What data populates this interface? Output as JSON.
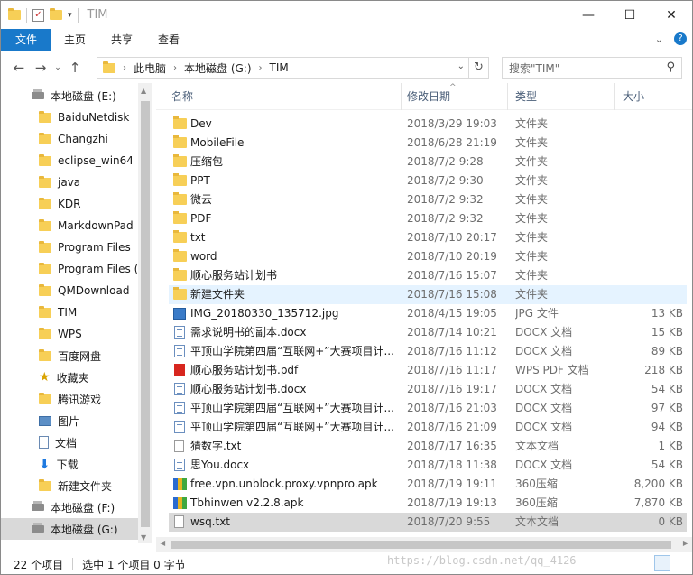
{
  "window": {
    "title": "TIM",
    "controls": [
      "minimize",
      "maximize",
      "close"
    ]
  },
  "ribbon": {
    "tabs": [
      "文件",
      "主页",
      "共享",
      "查看"
    ]
  },
  "nav": {
    "breadcrumb": [
      "此电脑",
      "本地磁盘 (G:)",
      "TIM"
    ],
    "search_placeholder": "搜索\"TIM\""
  },
  "sidebar": [
    {
      "label": "本地磁盘 (E:)",
      "icon": "drive-icon",
      "indent": 0
    },
    {
      "label": "BaiduNetdisk",
      "icon": "folder-icon",
      "indent": 1
    },
    {
      "label": "Changzhi",
      "icon": "folder-icon",
      "indent": 1
    },
    {
      "label": "eclipse_win64",
      "icon": "folder-icon",
      "indent": 1
    },
    {
      "label": "java",
      "icon": "folder-icon",
      "indent": 1
    },
    {
      "label": "KDR",
      "icon": "folder-icon",
      "indent": 1
    },
    {
      "label": "MarkdownPad",
      "icon": "folder-icon",
      "indent": 1
    },
    {
      "label": "Program Files",
      "icon": "folder-icon",
      "indent": 1
    },
    {
      "label": "Program Files (",
      "icon": "folder-icon",
      "indent": 1
    },
    {
      "label": "QMDownload",
      "icon": "folder-icon",
      "indent": 1
    },
    {
      "label": "TIM",
      "icon": "folder-icon",
      "indent": 1
    },
    {
      "label": "WPS",
      "icon": "folder-icon",
      "indent": 1
    },
    {
      "label": "百度网盘",
      "icon": "folder-icon",
      "indent": 1
    },
    {
      "label": "收藏夹",
      "icon": "star-icon",
      "indent": 1
    },
    {
      "label": "腾讯游戏",
      "icon": "folder-icon",
      "indent": 1
    },
    {
      "label": "图片",
      "icon": "picture-icon",
      "indent": 1
    },
    {
      "label": "文档",
      "icon": "document-icon",
      "indent": 1
    },
    {
      "label": "下载",
      "icon": "download-icon",
      "indent": 1
    },
    {
      "label": "新建文件夹",
      "icon": "folder-icon",
      "indent": 1
    },
    {
      "label": "本地磁盘 (F:)",
      "icon": "drive-icon",
      "indent": 0
    },
    {
      "label": "本地磁盘 (G:)",
      "icon": "drive-icon",
      "indent": 0,
      "selected": true
    }
  ],
  "columns": {
    "name": "名称",
    "date": "修改日期",
    "type": "类型",
    "size": "大小"
  },
  "files": [
    {
      "name": "Dev",
      "date": "2018/3/29 19:03",
      "type": "文件夹",
      "size": "",
      "icon": "folder-icon"
    },
    {
      "name": "MobileFile",
      "date": "2018/6/28 21:19",
      "type": "文件夹",
      "size": "",
      "icon": "folder-icon"
    },
    {
      "name": "压缩包",
      "date": "2018/7/2 9:28",
      "type": "文件夹",
      "size": "",
      "icon": "folder-icon"
    },
    {
      "name": "PPT",
      "date": "2018/7/2 9:30",
      "type": "文件夹",
      "size": "",
      "icon": "folder-icon"
    },
    {
      "name": "微云",
      "date": "2018/7/2 9:32",
      "type": "文件夹",
      "size": "",
      "icon": "folder-icon"
    },
    {
      "name": "PDF",
      "date": "2018/7/2 9:32",
      "type": "文件夹",
      "size": "",
      "icon": "folder-icon"
    },
    {
      "name": "txt",
      "date": "2018/7/10 20:17",
      "type": "文件夹",
      "size": "",
      "icon": "folder-icon"
    },
    {
      "name": "word",
      "date": "2018/7/10 20:19",
      "type": "文件夹",
      "size": "",
      "icon": "folder-icon"
    },
    {
      "name": "顺心服务站计划书",
      "date": "2018/7/16 15:07",
      "type": "文件夹",
      "size": "",
      "icon": "folder-icon"
    },
    {
      "name": "新建文件夹",
      "date": "2018/7/16 15:08",
      "type": "文件夹",
      "size": "",
      "icon": "folder-icon",
      "hover": true
    },
    {
      "name": "IMG_20180330_135712.jpg",
      "date": "2018/4/15 19:05",
      "type": "JPG 文件",
      "size": "13 KB",
      "icon": "image-icon"
    },
    {
      "name": "需求说明书的副本.docx",
      "date": "2018/7/14 10:21",
      "type": "DOCX 文档",
      "size": "15 KB",
      "icon": "docx-icon"
    },
    {
      "name": "平顶山学院第四届“互联网+”大赛项目计...",
      "date": "2018/7/16 11:12",
      "type": "DOCX 文档",
      "size": "89 KB",
      "icon": "docx-icon"
    },
    {
      "name": "顺心服务站计划书.pdf",
      "date": "2018/7/16 11:17",
      "type": "WPS PDF 文档",
      "size": "218 KB",
      "icon": "pdf-icon"
    },
    {
      "name": "顺心服务站计划书.docx",
      "date": "2018/7/16 19:17",
      "type": "DOCX 文档",
      "size": "54 KB",
      "icon": "docx-icon"
    },
    {
      "name": "平顶山学院第四届“互联网+”大赛项目计...",
      "date": "2018/7/16 21:03",
      "type": "DOCX 文档",
      "size": "97 KB",
      "icon": "docx-icon"
    },
    {
      "name": "平顶山学院第四届“互联网+”大赛项目计...",
      "date": "2018/7/16 21:09",
      "type": "DOCX 文档",
      "size": "94 KB",
      "icon": "docx-icon"
    },
    {
      "name": "猜数字.txt",
      "date": "2018/7/17 16:35",
      "type": "文本文档",
      "size": "1 KB",
      "icon": "txt-icon"
    },
    {
      "name": "思You.docx",
      "date": "2018/7/18 11:38",
      "type": "DOCX 文档",
      "size": "54 KB",
      "icon": "docx-icon"
    },
    {
      "name": "free.vpn.unblock.proxy.vpnpro.apk",
      "date": "2018/7/19 19:11",
      "type": "360压缩",
      "size": "8,200 KB",
      "icon": "apk-icon"
    },
    {
      "name": "Tbhinwen v2.2.8.apk",
      "date": "2018/7/19 19:13",
      "type": "360压缩",
      "size": "7,870 KB",
      "icon": "apk-icon"
    },
    {
      "name": "wsq.txt",
      "date": "2018/7/20 9:55",
      "type": "文本文档",
      "size": "0 KB",
      "icon": "txt-icon",
      "selected": true
    }
  ],
  "status": {
    "count": "22 个项目",
    "selection": "选中 1 个项目 0 字节"
  },
  "watermark": "https://blog.csdn.net/qq_4126"
}
